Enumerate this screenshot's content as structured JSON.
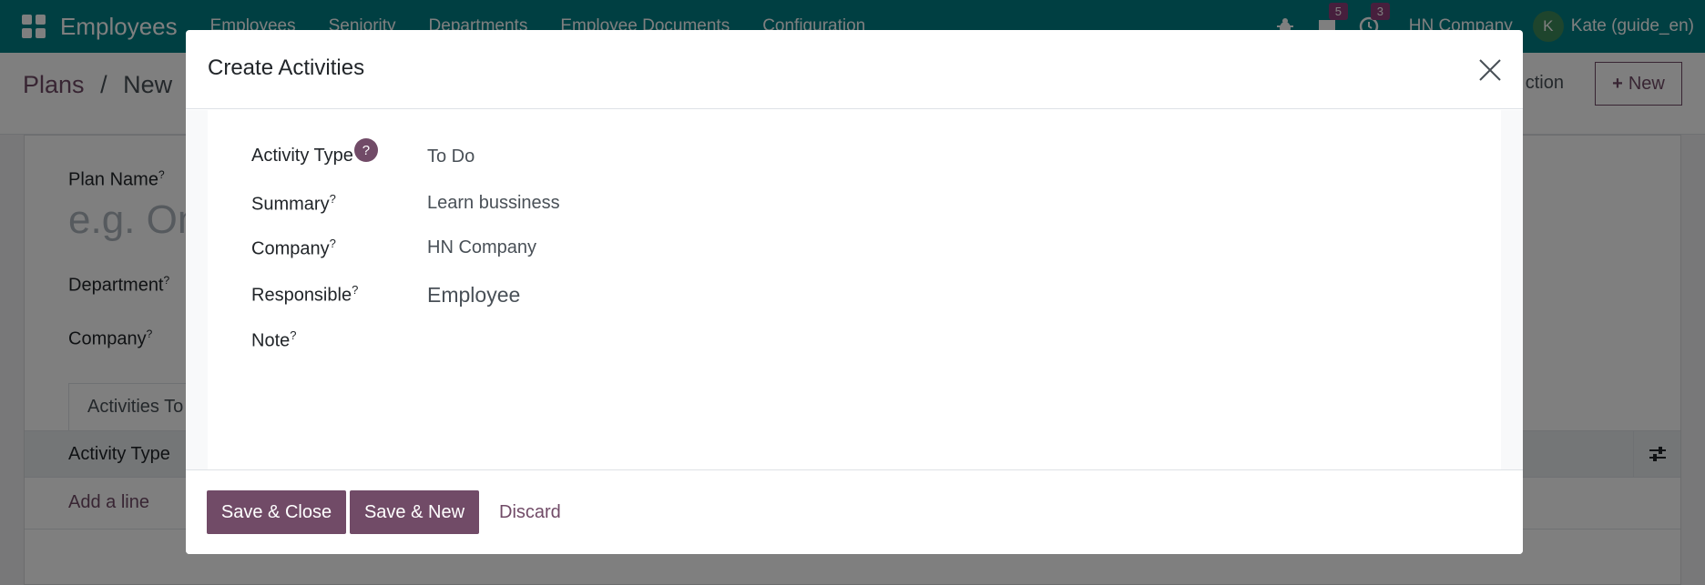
{
  "navbar": {
    "app_name": "Employees",
    "menu": [
      "Employees",
      "Seniority",
      "Departments",
      "Employee Documents",
      "Configuration"
    ],
    "chat_count": "5",
    "activity_count": "3",
    "company": "HN Company",
    "avatar_initial": "K",
    "user": "Kate (guide_en)"
  },
  "control_panel": {
    "breadcrumb_parent": "Plans",
    "breadcrumb_sep": "/",
    "breadcrumb_current": "New",
    "action_label": "ction",
    "new_button": "New"
  },
  "form": {
    "plan_name_label": "Plan Name",
    "plan_name_placeholder": "e.g. On",
    "department_label": "Department",
    "company_label": "Company",
    "tab_label": "Activities To",
    "list_column": "Activity Type",
    "add_line": "Add a line"
  },
  "modal": {
    "title": "Create Activities",
    "fields": {
      "activity_type": {
        "label": "Activity Type",
        "value": "To Do"
      },
      "summary": {
        "label": "Summary",
        "value": "Learn bussiness"
      },
      "company": {
        "label": "Company",
        "value": "HN Company"
      },
      "responsible": {
        "label": "Responsible",
        "value": "Employee"
      },
      "note": {
        "label": "Note",
        "value": ""
      }
    },
    "help_mark": "?",
    "buttons": {
      "save_close": "Save & Close",
      "save_new": "Save & New",
      "discard": "Discard"
    }
  },
  "colors": {
    "navbar": "#017e84",
    "brand": "#714b67",
    "badge": "#8f3f7a"
  }
}
